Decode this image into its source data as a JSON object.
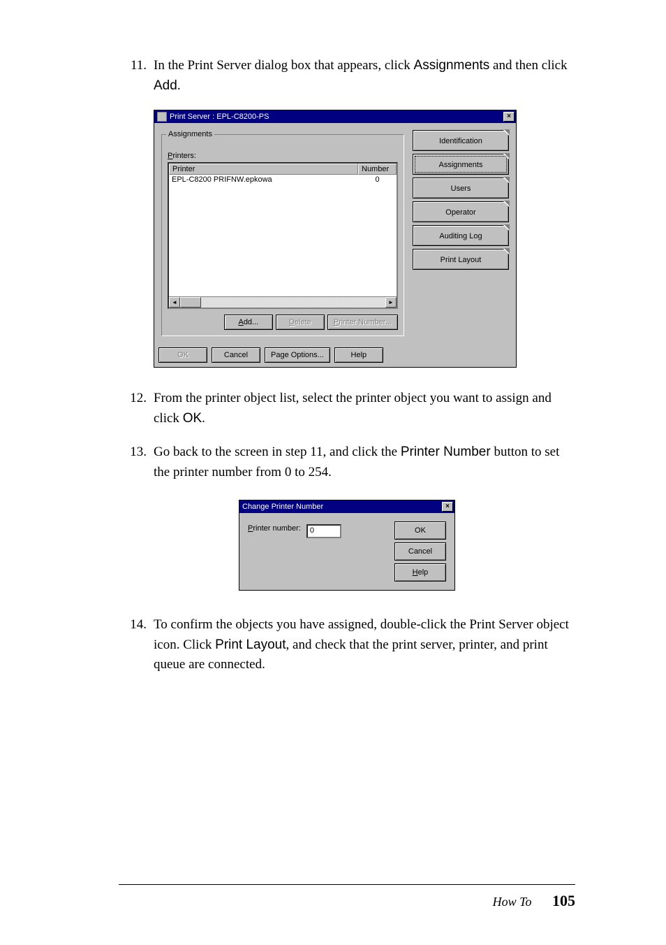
{
  "step11": {
    "num": "11.",
    "text_before": "In the Print Server dialog box that appears, click ",
    "ui1": "Assignments",
    "text_mid": " and then click ",
    "ui2": "Add",
    "text_after": "."
  },
  "step12": {
    "num": "12.",
    "text_before": "From the printer object list, select the printer object you want to assign and click ",
    "ui1": "OK",
    "text_after": "."
  },
  "step13": {
    "num": "13.",
    "text_before": "Go back to the screen in step 11, and click the ",
    "ui1": "Printer Number",
    "text_after": " button to set the printer number from 0 to 254."
  },
  "step14": {
    "num": "14.",
    "text_before": "To confirm the objects you have assigned, double-click the Print Server object icon. Click ",
    "ui1": "Print Layout",
    "text_after": ", and check that the print server, printer, and print queue are connected."
  },
  "dialog1": {
    "title": "Print Server :  EPL-C8200-PS",
    "close": "×",
    "group_label": "Assignments",
    "printers_label_u": "P",
    "printers_label_rest": "rinters:",
    "col_printer": "Printer",
    "col_number": "Number",
    "row_printer": "EPL-C8200 PRIFNW.epkowa",
    "row_number": "0",
    "btn_add_u": "A",
    "btn_add_rest": "dd...",
    "btn_delete_u": "D",
    "btn_delete_rest": "elete",
    "btn_pnum_u": "P",
    "btn_pnum_rest": "rinter Number...",
    "btn_ok": "OK",
    "btn_cancel": "Cancel",
    "btn_pageopt": "Page Options...",
    "btn_help": "Help",
    "tab_identification": "Identification",
    "tab_assignments": "Assignments",
    "tab_users": "Users",
    "tab_operator": "Operator",
    "tab_auditing": "Auditing Log",
    "tab_printlayout": "Print Layout"
  },
  "dialog2": {
    "title": "Change Printer Number",
    "close": "×",
    "label_u": "P",
    "label_rest": "rinter number:",
    "value": "0",
    "btn_ok": "OK",
    "btn_cancel": "Cancel",
    "btn_help_u": "H",
    "btn_help_rest": "elp"
  },
  "footer": {
    "section": "How To",
    "page": "105"
  }
}
